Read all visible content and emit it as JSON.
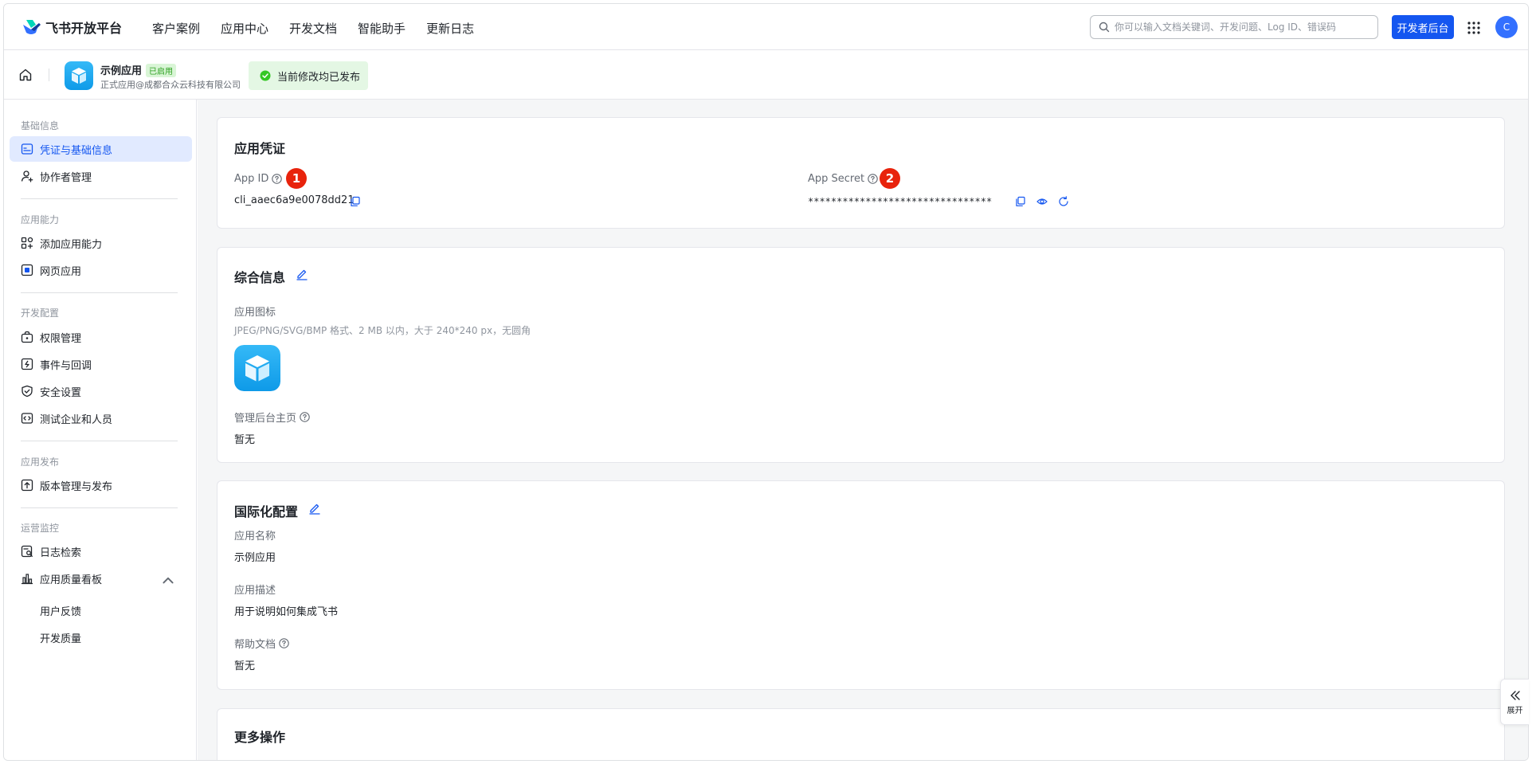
{
  "topnav": {
    "brand": "飞书开放平台",
    "links": [
      "客户案例",
      "应用中心",
      "开发文档",
      "智能助手",
      "更新日志"
    ],
    "search_placeholder": "你可以输入文档关键词、开发问题、Log ID、错误码",
    "dev_console_label": "开发者后台",
    "avatar_letter": "C"
  },
  "subheader": {
    "app_name": "示例应用",
    "app_badge": "已启用",
    "app_owner": "正式应用@成都合众云科技有限公司",
    "publish_status": "当前修改均已发布"
  },
  "sidebar": {
    "groups": [
      {
        "title": "基础信息",
        "items": [
          "凭证与基础信息",
          "协作者管理"
        ]
      },
      {
        "title": "应用能力",
        "items": [
          "添加应用能力",
          "网页应用"
        ]
      },
      {
        "title": "开发配置",
        "items": [
          "权限管理",
          "事件与回调",
          "安全设置",
          "测试企业和人员"
        ]
      },
      {
        "title": "应用发布",
        "items": [
          "版本管理与发布"
        ]
      },
      {
        "title": "运营监控",
        "items": [
          "日志检索",
          "应用质量看板"
        ]
      }
    ],
    "quality_subitems": [
      "用户反馈",
      "开发质量"
    ]
  },
  "credentials": {
    "title": "应用凭证",
    "app_id_label": "App ID",
    "app_id_value": "cli_aaec6a9e0078dd21",
    "app_id_badge": "1",
    "app_secret_label": "App Secret",
    "app_secret_value": "********************************",
    "app_secret_badge": "2"
  },
  "general": {
    "title": "综合信息",
    "icon_label": "应用图标",
    "icon_hint": "JPEG/PNG/SVG/BMP 格式、2 MB 以内，大于 240*240 px，无圆角",
    "admin_home_label": "管理后台主页",
    "admin_home_value": "暂无"
  },
  "i18n": {
    "title": "国际化配置",
    "name_label": "应用名称",
    "name_value": "示例应用",
    "desc_label": "应用描述",
    "desc_value": "用于说明如何集成飞书",
    "help_label": "帮助文档",
    "help_value": "暂无"
  },
  "more": {
    "title": "更多操作"
  },
  "expand_label": "展开",
  "colors": {
    "accent": "#1456f0",
    "badge_red": "#e8230c",
    "success_bg": "#e4f7e4",
    "active_bg": "#e1eaff"
  }
}
